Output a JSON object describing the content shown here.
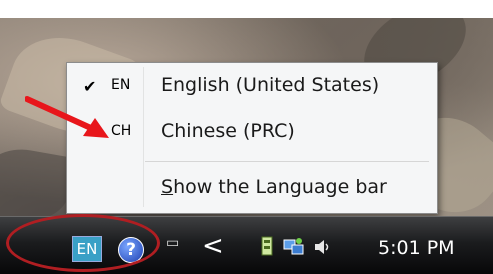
{
  "language_menu": {
    "items": [
      {
        "checked": true,
        "check_glyph": "✔",
        "code": "EN",
        "label": "English (United States)"
      },
      {
        "checked": false,
        "check_glyph": "",
        "code": "CH",
        "label": "Chinese (PRC)"
      }
    ],
    "show_bar_label_first": "S",
    "show_bar_label_rest": "how the Language bar"
  },
  "taskbar": {
    "language_button": "EN",
    "help_icon": "help-icon",
    "restore_icon": "restore-icon",
    "chevron_glyph": "<",
    "clock": "5:01 PM"
  },
  "annotation_colors": {
    "arrow": "#e8161b",
    "oval": "#b01e22"
  }
}
